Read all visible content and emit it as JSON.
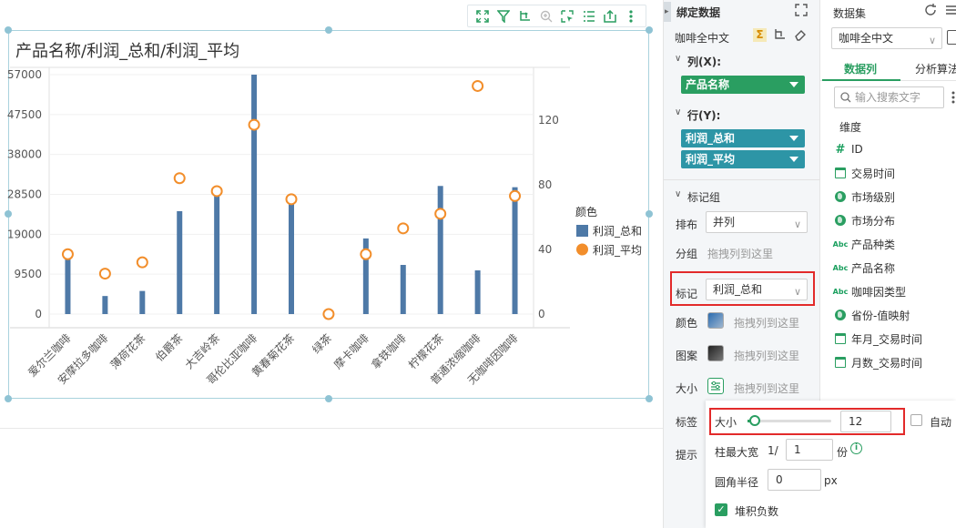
{
  "chart_title": "产品名称/利润_总和/利润_平均",
  "toolbar": {
    "icons": [
      "expand-icon",
      "filter-icon",
      "drill-icon",
      "zoom-icon",
      "select-icon",
      "list-icon",
      "export-icon",
      "more-icon"
    ]
  },
  "chart_data": {
    "type": "bar",
    "categories": [
      "爱尔兰咖啡",
      "安摩拉多咖啡",
      "薄荷花茶",
      "伯爵茶",
      "大吉岭茶",
      "哥伦比亚咖啡",
      "黄春菊花茶",
      "绿茶",
      "摩卡咖啡",
      "拿铁咖啡",
      "柠檬花茶",
      "普通浓缩咖啡",
      "无咖啡因咖啡"
    ],
    "series": [
      {
        "name": "利润_总和",
        "type": "bar",
        "axis": "left",
        "values": [
          14100,
          4300,
          5500,
          24500,
          29600,
          57000,
          28600,
          0,
          18000,
          11700,
          30500,
          10400,
          30200
        ]
      },
      {
        "name": "利润_平均",
        "type": "scatter",
        "axis": "right",
        "values": [
          37,
          25,
          32,
          84,
          76,
          117,
          71,
          0,
          37,
          53,
          62,
          141,
          73
        ]
      }
    ],
    "y_left": {
      "ticks": [
        "0",
        "9500",
        "19000",
        "28500",
        "38000",
        "47500",
        "57000"
      ],
      "min": 0,
      "max": 57000
    },
    "y_right": {
      "ticks": [
        "0",
        "40",
        "80",
        "120"
      ],
      "min": 0,
      "max": 148
    },
    "legend_title": "颜色",
    "legend_position": "right",
    "colors": {
      "bar": "#4e79a7",
      "dot": "#f28e2b"
    }
  },
  "bind_panel": {
    "header": "绑定数据",
    "dataset": "咖啡全中文",
    "col_label": "列(X):",
    "col_pill": "产品名称",
    "row_label": "行(Y):",
    "row_pills": [
      "利润_总和",
      "利润_平均"
    ],
    "mark_group": "标记组",
    "layout_label": "排布",
    "layout_value": "并列",
    "group_label": "分组",
    "group_hint": "拖拽列到这里",
    "mark_label": "标记",
    "mark_value": "利润_总和",
    "color_label": "颜色",
    "color_hint": "拖拽列到这里",
    "shape_label": "图案",
    "shape_hint": "拖拽列到这里",
    "size_label": "大小",
    "size_hint": "拖拽列到这里",
    "tag_label": "标签",
    "tip_label": "提示"
  },
  "size_popup": {
    "size_label": "大小",
    "size_value": "12",
    "auto_label": "自动",
    "col_width_label": "柱最大宽",
    "col_width_prefix": "1/",
    "col_width_value": "1",
    "col_width_unit": "份",
    "radius_label": "圆角半径",
    "radius_value": "0",
    "radius_unit": "px",
    "stack_label": "堆积负数",
    "stack_checked": true
  },
  "dataset_panel": {
    "header": "数据集",
    "dataset_value": "咖啡全中文",
    "tab_active": "数据列",
    "tab_other": "分析算法",
    "search_placeholder": "输入搜索文字",
    "dim_header": "维度",
    "fields": [
      {
        "icon": "hash-icon",
        "label": "ID"
      },
      {
        "icon": "calendar-icon",
        "label": "交易时间"
      },
      {
        "icon": "globe-icon",
        "label": "市场级别"
      },
      {
        "icon": "globe-icon",
        "label": "市场分布"
      },
      {
        "icon": "text-icon",
        "label": "产品种类"
      },
      {
        "icon": "text-icon",
        "label": "产品名称"
      },
      {
        "icon": "text-icon",
        "label": "咖啡因类型"
      },
      {
        "icon": "globe-icon",
        "label": "省份-值映射"
      },
      {
        "icon": "calendar-icon",
        "label": "年月_交易时间"
      },
      {
        "icon": "calendar-icon",
        "label": "月数_交易时间"
      }
    ]
  }
}
